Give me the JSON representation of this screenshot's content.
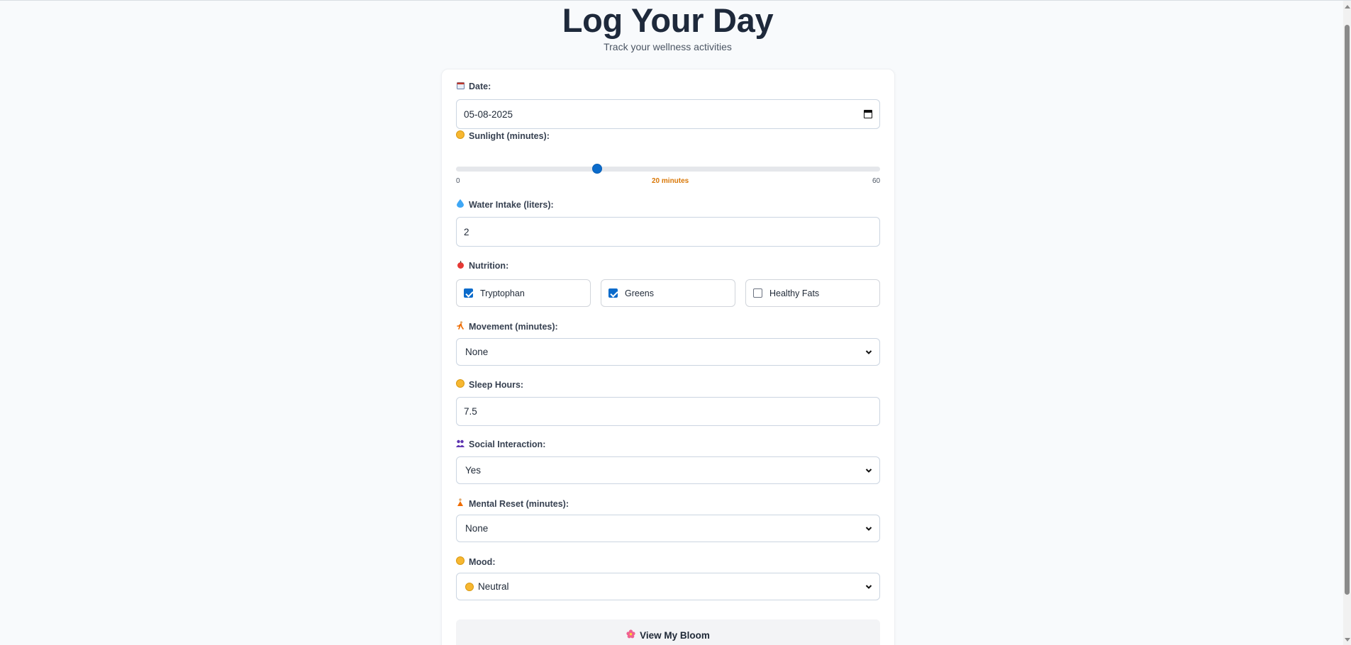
{
  "header": {
    "title": "Log Your Day",
    "subtitle": "Track your wellness activities"
  },
  "form": {
    "date": {
      "icon": "calendar-icon",
      "label": "Date:",
      "value": "05-08-2025"
    },
    "sunlight": {
      "icon": "sun-face-icon",
      "label": "Sunlight (minutes):",
      "min_label": "0",
      "max_label": "60",
      "min": 0,
      "max": 60,
      "value": 20,
      "value_label": "20 minutes"
    },
    "water": {
      "icon": "droplet-icon",
      "label": "Water Intake (liters):",
      "value": "2"
    },
    "nutrition": {
      "icon": "apple-icon",
      "label": "Nutrition:",
      "options": [
        {
          "label": "Tryptophan",
          "checked": true
        },
        {
          "label": "Greens",
          "checked": true
        },
        {
          "label": "Healthy Fats",
          "checked": false
        }
      ]
    },
    "movement": {
      "icon": "running-icon",
      "label": "Movement (minutes):",
      "selected": "None"
    },
    "sleep": {
      "icon": "sleeping-face-icon",
      "label": "Sleep Hours:",
      "value": "7.5"
    },
    "social": {
      "icon": "people-icon",
      "label": "Social Interaction:",
      "selected": "Yes"
    },
    "mental_reset": {
      "icon": "meditation-icon",
      "label": "Mental Reset (minutes):",
      "selected": "None"
    },
    "mood": {
      "icon": "smiley-icon",
      "label": "Mood:",
      "selected": "Neutral",
      "selected_icon": "neutral-face-icon"
    }
  },
  "actions": {
    "view_bloom": {
      "icon": "flower-icon",
      "label": "View My Bloom"
    }
  },
  "colors": {
    "accent": "#0b6bcb",
    "slider_value": "#d97706",
    "title": "#1e293b",
    "background": "#f8fafc"
  }
}
